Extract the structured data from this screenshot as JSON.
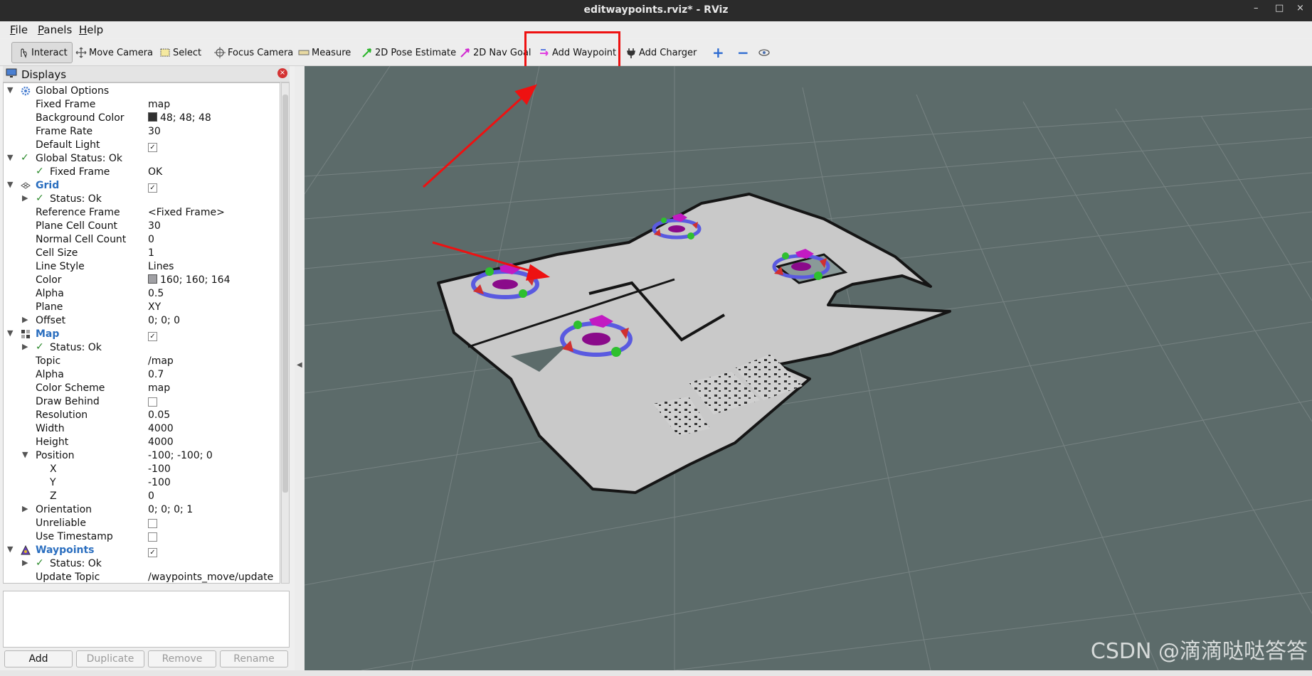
{
  "window": {
    "title": "editwaypoints.rviz* - RViz",
    "controls": [
      "–",
      "□",
      "×"
    ]
  },
  "menu": {
    "file": "File",
    "panels": "Panels",
    "help": "Help"
  },
  "toolbar": {
    "interact": "Interact",
    "move_camera": "Move Camera",
    "select": "Select",
    "focus_camera": "Focus Camera",
    "measure": "Measure",
    "pose_estimate": "2D Pose Estimate",
    "nav_goal": "2D Nav Goal",
    "add_waypoint": "Add Waypoint",
    "add_charger": "Add Charger",
    "plus": "+",
    "minus": "−"
  },
  "panel": {
    "title": "Displays",
    "rows": [
      {
        "name": "Global Options",
        "value": ""
      },
      {
        "name": "Fixed Frame",
        "value": "map"
      },
      {
        "name": "Background Color",
        "value": "48; 48; 48",
        "swatch": "#303030"
      },
      {
        "name": "Frame Rate",
        "value": "30"
      },
      {
        "name": "Default Light",
        "value": "",
        "check": true
      },
      {
        "name": "Global Status: Ok",
        "value": ""
      },
      {
        "name": "Fixed Frame",
        "value": "OK"
      },
      {
        "name": "Grid",
        "value": "",
        "check": true
      },
      {
        "name": "Status: Ok",
        "value": ""
      },
      {
        "name": "Reference Frame",
        "value": "<Fixed Frame>"
      },
      {
        "name": "Plane Cell Count",
        "value": "30"
      },
      {
        "name": "Normal Cell Count",
        "value": "0"
      },
      {
        "name": "Cell Size",
        "value": "1"
      },
      {
        "name": "Line Style",
        "value": "Lines"
      },
      {
        "name": "Color",
        "value": "160; 160; 164",
        "swatch": "#a0a0a4"
      },
      {
        "name": "Alpha",
        "value": "0.5"
      },
      {
        "name": "Plane",
        "value": "XY"
      },
      {
        "name": "Offset",
        "value": "0; 0; 0"
      },
      {
        "name": "Map",
        "value": "",
        "check": true
      },
      {
        "name": "Status: Ok",
        "value": ""
      },
      {
        "name": "Topic",
        "value": "/map"
      },
      {
        "name": "Alpha",
        "value": "0.7"
      },
      {
        "name": "Color Scheme",
        "value": "map"
      },
      {
        "name": "Draw Behind",
        "value": "",
        "check": false
      },
      {
        "name": "Resolution",
        "value": "0.05"
      },
      {
        "name": "Width",
        "value": "4000"
      },
      {
        "name": "Height",
        "value": "4000"
      },
      {
        "name": "Position",
        "value": "-100; -100; 0"
      },
      {
        "name": "X",
        "value": "-100"
      },
      {
        "name": "Y",
        "value": "-100"
      },
      {
        "name": "Z",
        "value": "0"
      },
      {
        "name": "Orientation",
        "value": "0; 0; 0; 1"
      },
      {
        "name": "Unreliable",
        "value": "",
        "check": false
      },
      {
        "name": "Use Timestamp",
        "value": "",
        "check": false
      },
      {
        "name": "Waypoints",
        "value": "",
        "check": true
      },
      {
        "name": "Status: Ok",
        "value": ""
      },
      {
        "name": "Update Topic",
        "value": "/waypoints_move/update"
      }
    ],
    "buttons": {
      "add": "Add",
      "duplicate": "Duplicate",
      "remove": "Remove",
      "rename": "Rename"
    }
  },
  "viewport": {
    "background": "#5c6b6a",
    "map_floor": "#c9c9c9",
    "waypoint_ring": "#5a5ae0",
    "waypoint_center": "#8a0a8a"
  },
  "watermark": "CSDN @滴滴哒哒答答",
  "colors": {
    "highlight": "#ee1111",
    "ok_green": "#2c8a2c",
    "link_blue": "#2a6ebf"
  }
}
